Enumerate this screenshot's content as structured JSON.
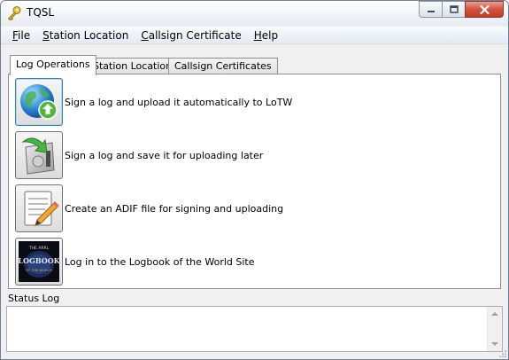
{
  "window": {
    "title": "TQSL"
  },
  "menu": [
    {
      "underline": "F",
      "rest": "ile"
    },
    {
      "underline": "S",
      "rest": "tation Location"
    },
    {
      "underline": "C",
      "rest": "allsign Certificate"
    },
    {
      "underline": "H",
      "rest": "elp"
    }
  ],
  "tabs": [
    {
      "label": "Log Operations",
      "active": true
    },
    {
      "label": "Station Locations",
      "active": false
    },
    {
      "label": "Callsign Certificates",
      "active": false
    }
  ],
  "operations": [
    {
      "label": "Sign a log and upload it automatically to LoTW",
      "icon": "globe-upload-icon"
    },
    {
      "label": "Sign a log and save it for uploading later",
      "icon": "save-arrow-icon"
    },
    {
      "label": "Create an ADIF file for signing and uploading",
      "icon": "notepad-pencil-icon"
    },
    {
      "label": "Log in to the Logbook of the World Site",
      "icon": "logbook-logo-icon"
    }
  ],
  "logo_text": {
    "top": "THE ARRL",
    "main": "LOGBOOK",
    "sub": "OF THE WORLD"
  },
  "status": {
    "label": "Status Log",
    "content": ""
  }
}
